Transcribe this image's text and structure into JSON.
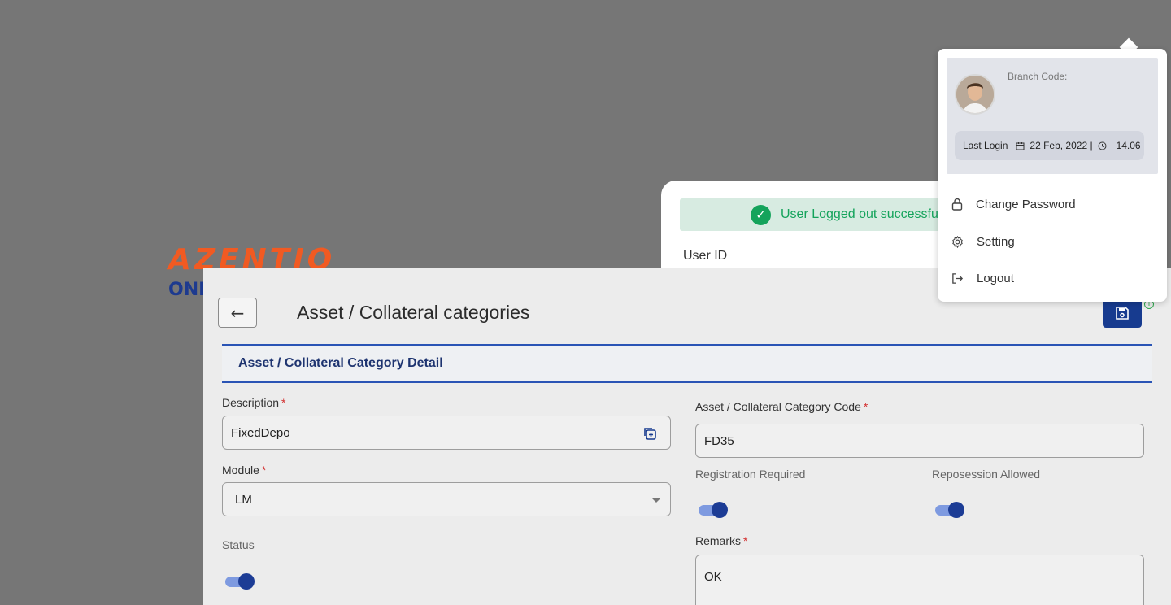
{
  "login_page": {
    "brand_logo": "AZENTIO",
    "brand_sub": "ONE",
    "toast_message": "User Logged out successfully",
    "user_id_label": "User ID"
  },
  "dialog": {
    "title": "Asset / Collateral categories",
    "section_tab": "Asset / Collateral Category Detail",
    "fields": {
      "description_label": "Description",
      "description_value": "FixedDepo",
      "module_label": "Module",
      "module_value": "LM",
      "status_label": "Status",
      "status_on": true,
      "category_code_label": "Asset / Collateral Category Code",
      "category_code_value": "FD35",
      "registration_required_label": "Registration Required",
      "registration_required_on": true,
      "repossession_allowed_label": "Reposession Allowed",
      "repossession_allowed_on": true,
      "remarks_label": "Remarks",
      "remarks_value": "OK"
    },
    "required_marker": "*"
  },
  "user_menu": {
    "branch_code_label": "Branch Code:",
    "last_login_label": "Last Login",
    "last_login_date": "22 Feb, 2022 |",
    "last_login_time": "14.06",
    "items": [
      {
        "label": "Change Password",
        "icon": "lock-icon"
      },
      {
        "label": "Setting",
        "icon": "gear-icon"
      },
      {
        "label": "Logout",
        "icon": "logout-icon"
      }
    ]
  },
  "colors": {
    "brand_orange": "#f15a22",
    "brand_blue": "#1d3a8f",
    "primary": "#173b8f",
    "success": "#14a35b",
    "required": "#d32f2f"
  }
}
